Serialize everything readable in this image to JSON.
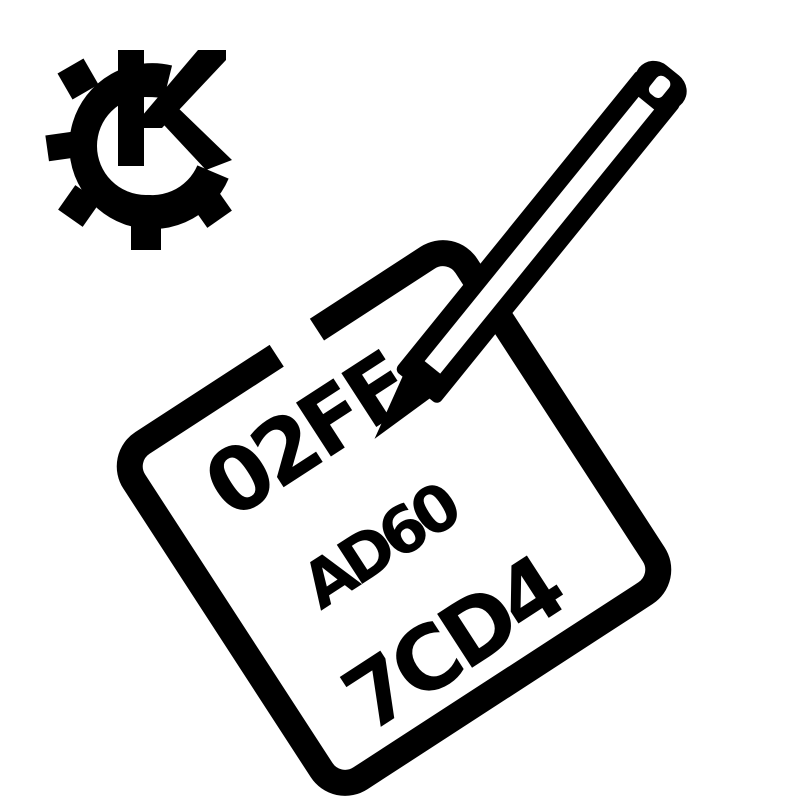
{
  "icon": {
    "name": "kde-hex-editor-icon",
    "foreground": "#000000",
    "background": "#ffffff",
    "logo_letter": "K",
    "sheet_lines": [
      {
        "text": "02FF"
      },
      {
        "text": "AD60"
      },
      {
        "text": "7CD4"
      }
    ]
  }
}
